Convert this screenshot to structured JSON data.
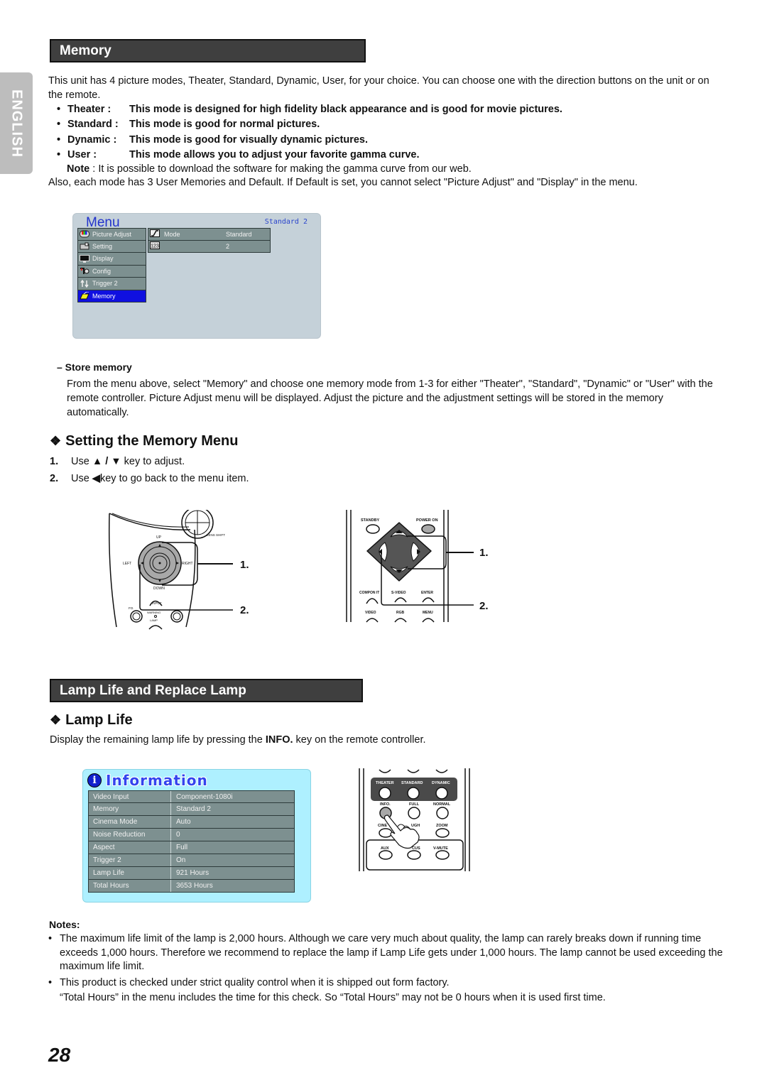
{
  "side_tab": {
    "language": "ENGLISH"
  },
  "memory_section": {
    "title": "Memory",
    "intro": "This unit has 4 picture modes, Theater, Standard, Dynamic, User, for your choice. You can choose one with the direction buttons on the unit or on the remote.",
    "modes": [
      {
        "name": "Theater :",
        "desc": "This mode is designed for high fidelity black appearance and is good for movie pictures."
      },
      {
        "name": "Standard :",
        "desc": "This mode is good for normal pictures."
      },
      {
        "name": "Dynamic :",
        "desc": "This mode is good for visually dynamic pictures."
      },
      {
        "name": "User :",
        "desc": "This mode allows you to adjust your favorite gamma curve."
      }
    ],
    "note_label": "Note",
    "note_text": " : It is possible to download the software for making the gamma curve from our web.",
    "also_text": "Also, each mode has 3 User Memories and Default. If Default is set, you cannot select \"Picture Adjust\" and \"Display\" in the menu."
  },
  "osd_menu": {
    "title": "Menu",
    "status": "Standard 2",
    "nav_items": [
      {
        "label": "Picture Adjust",
        "icon": "picture-adjust-icon",
        "active": false
      },
      {
        "label": "Setting",
        "icon": "setting-icon",
        "active": false
      },
      {
        "label": "Display",
        "icon": "display-icon",
        "active": false
      },
      {
        "label": "Config",
        "icon": "config-icon",
        "active": false
      },
      {
        "label": "Trigger 2",
        "icon": "trigger-icon",
        "active": false
      },
      {
        "label": "Memory",
        "icon": "memory-icon",
        "active": true
      }
    ],
    "sub_rows": [
      {
        "icon": "gamma-curve-icon",
        "label": "Mode",
        "value": "Standard"
      },
      {
        "icon": "number-123-icon",
        "label": "",
        "value": "2"
      }
    ]
  },
  "store_memory": {
    "title": "–  Store memory",
    "body": "From the menu above, select \"Memory\" and choose one memory mode from 1-3 for either \"Theater\", \"Standard\", \"Dynamic\" or \"User\" with the remote controller. Picture Adjust menu will be displayed. Adjust the picture and the adjustment settings will be stored in the memory automatically."
  },
  "setting_section": {
    "title": "Setting the Memory Menu",
    "steps": [
      {
        "num": "1.",
        "pre": "Use ",
        "keys": "▲ / ▼",
        "post": " key to adjust."
      },
      {
        "num": "2.",
        "pre": "Use ",
        "keys": "◀",
        "post": " key to go back to the menu item."
      }
    ]
  },
  "projector_figure": {
    "labels": {
      "up": "UP",
      "down": "DOWN",
      "left": "LEFT",
      "right": "RIGHT",
      "lens_shift": "LENS SHIFT",
      "input": "INPUT",
      "warning": "WARNING",
      "lamp": "LAMP",
      "fo": "FO."
    },
    "callouts": [
      "1.",
      "2."
    ]
  },
  "remote_nav_figure": {
    "labels": {
      "standby": "STANDBY",
      "power_on": "POWER ON",
      "component": "COMPON  IT",
      "svideo": "S-VIDEO",
      "enter": "ENTER",
      "video": "VIDEO",
      "rgb": "RGB",
      "menu": "MENU"
    },
    "callouts": [
      "1.",
      "2."
    ]
  },
  "lamp_section": {
    "title": "Lamp Life and Replace Lamp",
    "subtitle": "Lamp Life",
    "desc_pre": "Display the remaining lamp life by pressing the ",
    "desc_key": "INFO.",
    "desc_post": " key on the remote controller."
  },
  "info_osd": {
    "title": "Information",
    "rows": [
      {
        "key": "Video Input",
        "value": "Component-1080i"
      },
      {
        "key": "Memory",
        "value": "Standard 2"
      },
      {
        "key": "Cinema Mode",
        "value": "Auto"
      },
      {
        "key": "Noise Reduction",
        "value": "0"
      },
      {
        "key": "Aspect",
        "value": "Full"
      },
      {
        "key": "Trigger 2",
        "value": "On"
      },
      {
        "key": "Lamp Life",
        "value": "921 Hours"
      },
      {
        "key": "Total Hours",
        "value": "3653 Hours"
      }
    ]
  },
  "remote_info_figure": {
    "labels": {
      "theater": "THEATER",
      "standard": "STANDARD",
      "dynamic": "DYNAMIC",
      "info": "INFO.",
      "full": "FULL",
      "normal": "NORMAL",
      "cinema": "CINE",
      "through": "UGH",
      "zoom": "ZOOM",
      "aux": "AUX",
      "focus": "CUS",
      "vmute": "V-MUTE"
    }
  },
  "notes": {
    "title": "Notes:",
    "items": [
      "The maximum life limit of the lamp is 2,000 hours. Although we care very much about quality, the lamp can rarely breaks down if running time exceeds 1,000 hours. Therefore we recommend to replace the lamp if Lamp Life gets under 1,000 hours. The lamp cannot be used exceeding the maximum life limit.",
      "This product is checked under strict quality control when it is shipped out form factory."
    ],
    "continuation": "“Total Hours” in the menu includes the time for this check. So “Total Hours” may not be 0 hours when it is used first time."
  },
  "page_number": "28"
}
